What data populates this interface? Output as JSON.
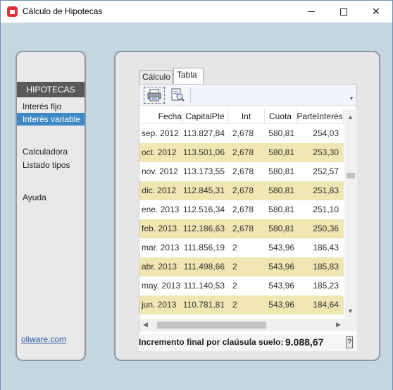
{
  "window": {
    "title": "Cálculo de Hipotecas",
    "minimize_label": "",
    "maximize_label": "",
    "close_label": "✕"
  },
  "sidebar": {
    "header": "HIPOTECAS",
    "items": [
      {
        "label": "Interés fijo",
        "selected": false
      },
      {
        "label": "Interés variable",
        "selected": true
      },
      {
        "label": "Calculadora",
        "selected": false
      },
      {
        "label": "Listado tipos",
        "selected": false
      },
      {
        "label": "Ayuda",
        "selected": false
      }
    ],
    "link": "oliware.com"
  },
  "tabs": [
    {
      "label": "Cálculo",
      "active": false
    },
    {
      "label": "Tabla",
      "active": true
    }
  ],
  "toolbar": {
    "icons": [
      "printer-icon",
      "export-document-icon"
    ],
    "overflow_glyph": "▾"
  },
  "table": {
    "columns": [
      "Fecha",
      "CapitalPte",
      "Int",
      "Cuota",
      "ParteInterés"
    ],
    "rows": [
      [
        "sep. 2012",
        "113.827,84",
        "2,678",
        "580,81",
        "254,03"
      ],
      [
        "oct. 2012",
        "113.501,06",
        "2,678",
        "580,81",
        "253,30"
      ],
      [
        "nov. 2012",
        "113.173,55",
        "2,678",
        "580,81",
        "252,57"
      ],
      [
        "dic. 2012",
        "112.845,31",
        "2,678",
        "580,81",
        "251,83"
      ],
      [
        "ene. 2013",
        "112.516,34",
        "2,678",
        "580,81",
        "251,10"
      ],
      [
        "feb. 2013",
        "112.186,63",
        "2,678",
        "580,81",
        "250,36"
      ],
      [
        "mar. 2013",
        "111.856,19",
        "2",
        "543,96",
        "186,43"
      ],
      [
        "abr. 2013",
        "111.498,66",
        "2",
        "543,96",
        "185,83"
      ],
      [
        "may. 2013",
        "111.140,53",
        "2",
        "543,96",
        "185,23"
      ],
      [
        "jun. 2013",
        "110.781,81",
        "2",
        "543,96",
        "184,64"
      ]
    ],
    "alt_row_color": "#efe6b2"
  },
  "footer": {
    "label": "Incremento final por claúsula suelo:",
    "value": "9.088,67",
    "help_label": "?"
  },
  "colors": {
    "accent": "#3e89c5",
    "background": "#c5d6e0",
    "app_icon": "#e0303c"
  }
}
